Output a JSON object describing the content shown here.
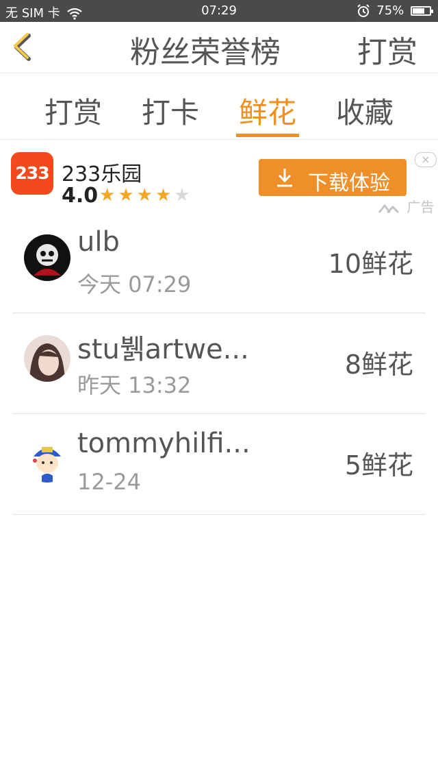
{
  "status_bar": {
    "carrier": "无 SIM 卡",
    "time": "07:29",
    "battery": "75%",
    "battery_level": 0.75
  },
  "header": {
    "title": "粉丝荣誉榜",
    "right_action": "打赏"
  },
  "tabs": [
    {
      "label": "打赏",
      "active": false
    },
    {
      "label": "打卡",
      "active": false
    },
    {
      "label": "鲜花",
      "active": true
    },
    {
      "label": "收藏",
      "active": false
    }
  ],
  "ad": {
    "logo_text": "233",
    "name": "233乐园",
    "rating": "4.0",
    "stars": 4,
    "button_label": "下载体验",
    "close": "×",
    "tag": "广告"
  },
  "list": [
    {
      "name": "ulb",
      "time": "今天 07:29",
      "amount": "10鲜花"
    },
    {
      "name": "stu뷁artwe...",
      "time": "昨天 13:32",
      "amount": "8鲜花"
    },
    {
      "name": "tommyhilfi...",
      "time": "12-24",
      "amount": "5鲜花"
    }
  ],
  "colors": {
    "accent": "#f0901e",
    "ad_button": "#ef8f29",
    "ad_logo": "#f24a1c"
  }
}
